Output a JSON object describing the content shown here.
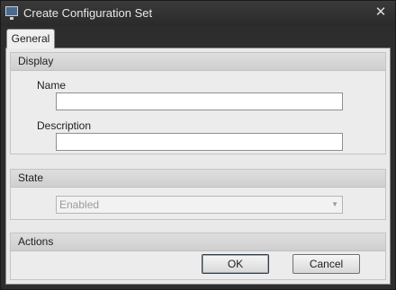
{
  "window": {
    "title": "Create Configuration Set",
    "app_icon": "monitor-icon",
    "close_glyph": "✕"
  },
  "tabs": [
    {
      "label": "General",
      "selected": true
    }
  ],
  "display": {
    "header": "Display",
    "name_label": "Name",
    "name_value": "",
    "description_label": "Description",
    "description_value": ""
  },
  "state": {
    "header": "State",
    "selected_value": "Enabled",
    "enabled": false
  },
  "actions": {
    "header": "Actions",
    "ok_label": "OK",
    "cancel_label": "Cancel"
  }
}
